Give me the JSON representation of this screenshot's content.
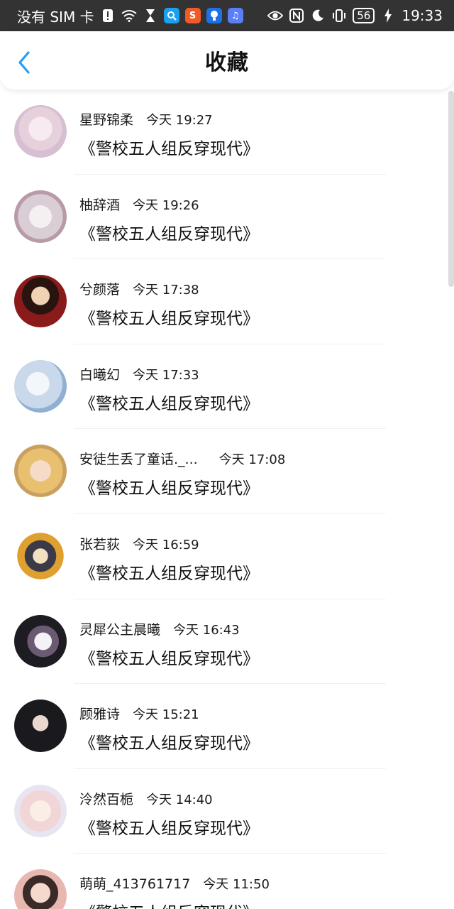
{
  "status_bar": {
    "carrier": "没有 SIM 卡",
    "battery": "56",
    "time": "19:33"
  },
  "header": {
    "title": "收藏",
    "back_icon": "chevron-left-icon",
    "accent_color": "#2a9cf0"
  },
  "favorites": [
    {
      "name": "星野锦柔",
      "time": "今天 19:27",
      "book": "《警校五人组反穿现代》"
    },
    {
      "name": "柚辞酒",
      "time": "今天 19:26",
      "book": "《警校五人组反穿现代》"
    },
    {
      "name": "兮颜落",
      "time": "今天 17:38",
      "book": "《警校五人组反穿现代》"
    },
    {
      "name": "白曦幻",
      "time": "今天 17:33",
      "book": "《警校五人组反穿现代》"
    },
    {
      "name": "安徒生丢了童话._...",
      "time": "今天 17:08",
      "book": "《警校五人组反穿现代》"
    },
    {
      "name": "张若荻",
      "time": "今天 16:59",
      "book": "《警校五人组反穿现代》"
    },
    {
      "name": "灵犀公主晨曦",
      "time": "今天 16:43",
      "book": "《警校五人组反穿现代》"
    },
    {
      "name": "顾雅诗",
      "time": "今天 15:21",
      "book": "《警校五人组反穿现代》"
    },
    {
      "name": "泠然百栀",
      "time": "今天 14:40",
      "book": "《警校五人组反穿现代》"
    },
    {
      "name": "萌萌_413761717",
      "time": "今天 11:50",
      "book": "《警校五人组反穿现代》"
    }
  ]
}
